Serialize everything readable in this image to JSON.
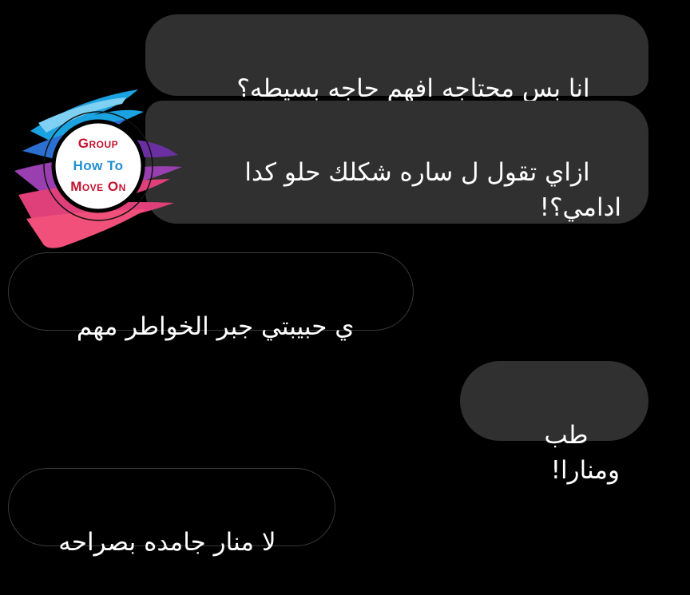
{
  "messages": [
    {
      "id": "b1",
      "direction": "sent",
      "text": "انا بس محتاجه افهم حاجه بسيطه؟"
    },
    {
      "id": "b2",
      "direction": "sent",
      "text": "ازاي تقول ل ساره شكلك حلو كدا\nادامي؟!"
    },
    {
      "id": "b3",
      "direction": "received",
      "text": "ي حبيبتي جبر الخواطر مهم"
    },
    {
      "id": "b4",
      "direction": "sent",
      "text": "طب ومنارا!"
    },
    {
      "id": "b5",
      "direction": "received",
      "text": "لا منار جامده بصراحه"
    }
  ],
  "watermark": {
    "line1": "Group",
    "line2": "How To",
    "line3": "Move On",
    "colors": {
      "line1": "#c4122f",
      "line2": "#1f8fd0",
      "line3": "#c4122f"
    }
  },
  "colors": {
    "background": "#000000",
    "sent_bubble": "#303030",
    "received_border": "#3a3a3a",
    "text": "#ffffff"
  }
}
